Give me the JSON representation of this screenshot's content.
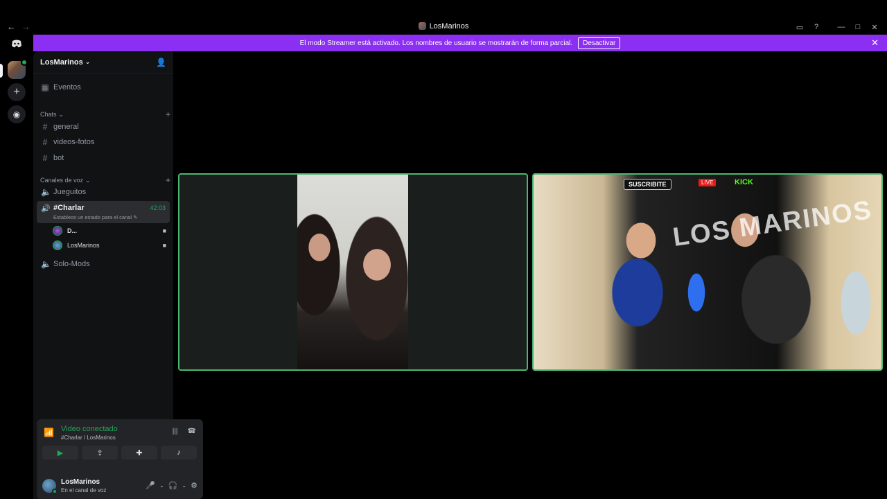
{
  "window": {
    "title": "LosMarinos",
    "controls": [
      "minimize",
      "maximize",
      "close"
    ]
  },
  "banner": {
    "text": "El modo Streamer está activado. Los nombres de usuario se mostrarán de forma parcial.",
    "button": "Desactivar"
  },
  "server": {
    "name": "LosMarinos"
  },
  "sidebar": {
    "events": "Eventos",
    "chats_category": "Chats",
    "text_channels": [
      "general",
      "videos-fotos",
      "bot"
    ],
    "voice_category": "Canales de voz",
    "voice_channels": {
      "first": "Jueguitos",
      "active": "#Charlar",
      "active_timer": "42:03",
      "active_status": "Establece un estado para el canal",
      "last": "Solo-Mods"
    },
    "voice_users": [
      "D...",
      "LosMarinos"
    ]
  },
  "voice_panel": {
    "status": "Video conectado",
    "location": "#Charlar / LosMarinos"
  },
  "user_panel": {
    "name": "LosMarinos",
    "status": "En el canal de voz"
  },
  "stream_overlay": {
    "subscribe": "SUSCRIBITE",
    "live": "LIVE",
    "platform": "KICK",
    "brand": "LOS MARINOS"
  },
  "colors": {
    "accent_green": "#23a55a",
    "banner_purple": "#8b2ff2",
    "tile_border": "#4ab772"
  }
}
